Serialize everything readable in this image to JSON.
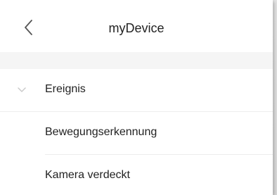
{
  "header": {
    "title": "myDevice",
    "back_icon": "chevron-left-icon"
  },
  "list": {
    "group_label": "Ereignis",
    "group_icon": "chevron-down-icon",
    "items": [
      {
        "label": "Bewegungserkennung"
      },
      {
        "label": "Kamera verdeckt"
      }
    ]
  },
  "colors": {
    "background": "#ffffff",
    "section_gap": "#f5f5f5",
    "divider": "#ededed",
    "text": "#222222",
    "icon": "#c8c8c8"
  }
}
